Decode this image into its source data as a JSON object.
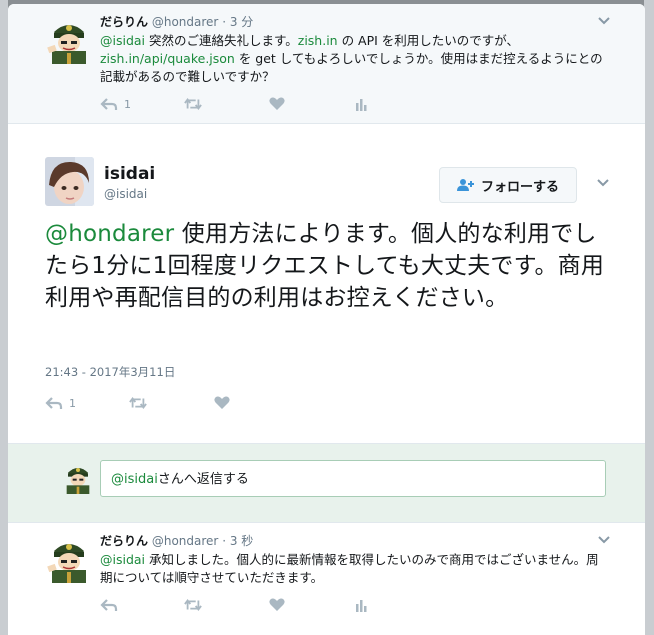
{
  "context_tweet": {
    "display_name": "だらりん",
    "screen_name": "@hondarer",
    "separator": "·",
    "time": "3 分",
    "text_parts": [
      {
        "t": "@isidai",
        "link": true
      },
      {
        "t": " 突然のご連絡失礼します。",
        "link": false
      },
      {
        "t": "zish.in",
        "link": true
      },
      {
        "t": " の API を利用したいのですが、",
        "link": false
      },
      {
        "t": "zish.in/api/quake.json",
        "link": true
      },
      {
        "t": " を get してもよろしいでしょうか。使用はまだ控えるようにとの記載があるので難しいですか？",
        "link": false
      }
    ],
    "reply_count": "1"
  },
  "main_tweet": {
    "display_name": "isidai",
    "screen_name": "@isidai",
    "follow_label": "フォローする",
    "mention": "@hondarer",
    "text": " 使用方法によります。個人的な利用でしたら1分に1回程度リクエストしても大丈夫です。商用利用や再配信目的の利用はお控えください。",
    "timestamp": "21:43 - 2017年3月11日",
    "reply_count": "1"
  },
  "reply_box": {
    "mention": "@isidai",
    "placeholder_text": "さんへ返信する"
  },
  "reply_tweet": {
    "display_name": "だらりん",
    "screen_name": "@hondarer",
    "separator": "·",
    "time": "3 秒",
    "mention": "@isidai",
    "text": " 承知しました。個人的に最新情報を取得したいのみで商用ではございません。周期については順守させていただきます。"
  },
  "colors": {
    "link": "#1b8a3c",
    "reply_bg": "#e8f2ec",
    "context_bg": "#f5f8fa",
    "action_icon": "#aab8c2"
  },
  "icons": [
    "reply-icon",
    "retweet-icon",
    "like-icon",
    "analytics-icon",
    "caret-down-icon",
    "follow-person-icon"
  ]
}
